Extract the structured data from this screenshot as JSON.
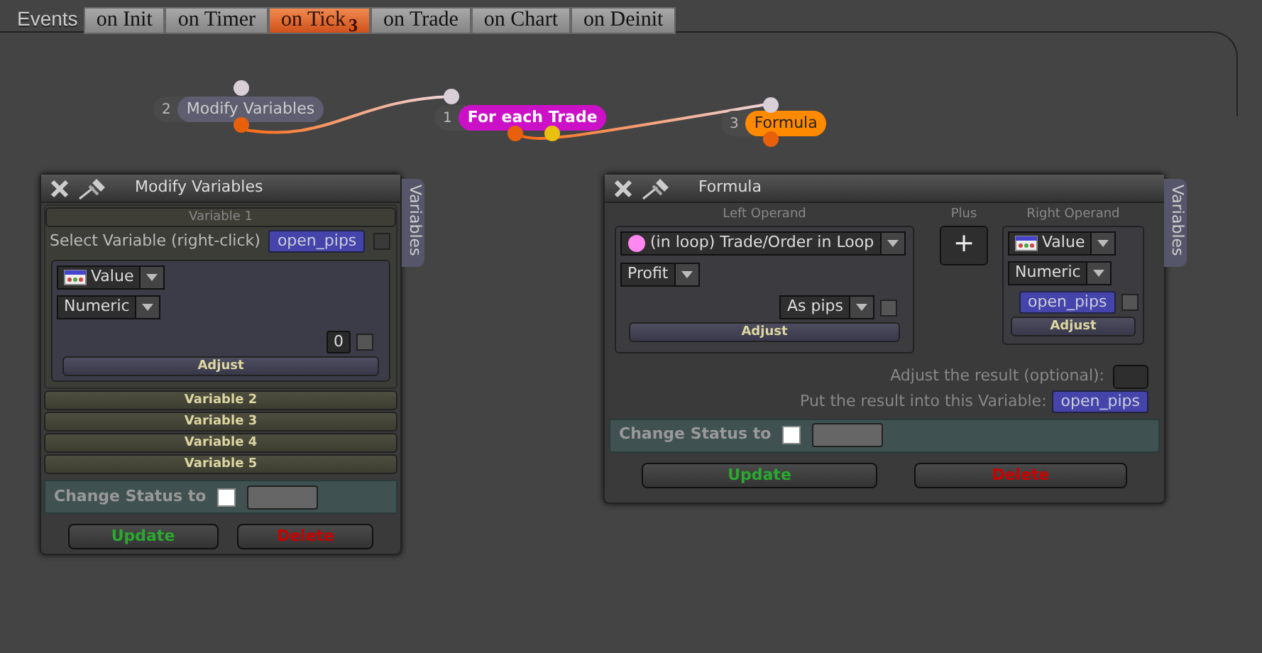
{
  "events_label": "Events",
  "tabs": [
    {
      "label": "on Init",
      "selected": false
    },
    {
      "label": "on Timer",
      "selected": false
    },
    {
      "label": "on Tick",
      "badge": "3",
      "selected": true
    },
    {
      "label": "on Trade",
      "selected": false
    },
    {
      "label": "on Chart",
      "selected": false
    },
    {
      "label": "on Deinit",
      "selected": false
    }
  ],
  "nodes": [
    {
      "number": "2",
      "label": "Modify Variables",
      "color": "#5e5e70"
    },
    {
      "number": "1",
      "label": "For each Trade",
      "color": "#cc10c8"
    },
    {
      "number": "3",
      "label": "Formula",
      "color": "#ff8a00"
    }
  ],
  "modify_window": {
    "title": "Modify Variables",
    "side_tab": "Variables",
    "sections": [
      {
        "title": "Variable 1",
        "expanded": true,
        "select_label": "Select Variable (right-click)",
        "variable": "open_pips",
        "variable_checked": false,
        "source": "Value",
        "type": "Numeric",
        "value": "0",
        "value_checked": false,
        "adjust": "Adjust"
      },
      {
        "title": "Variable 2",
        "expanded": false
      },
      {
        "title": "Variable 3",
        "expanded": false
      },
      {
        "title": "Variable 4",
        "expanded": false
      },
      {
        "title": "Variable 5",
        "expanded": false
      }
    ],
    "status_label": "Change Status to",
    "status_checked": false,
    "update": "Update",
    "delete": "Delete"
  },
  "formula_window": {
    "title": "Formula",
    "side_tab": "Variables",
    "left_operand": {
      "heading": "Left Operand",
      "source": "(in loop) Trade/Order in Loop",
      "field": "Profit",
      "mode": "As pips",
      "checked": false,
      "adjust": "Adjust"
    },
    "operator": {
      "heading": "Plus",
      "symbol": "+"
    },
    "right_operand": {
      "heading": "Right Operand",
      "source": "Value",
      "type": "Numeric",
      "variable": "open_pips",
      "checked": false,
      "adjust": "Adjust"
    },
    "adjust_label": "Adjust the result (optional):",
    "put_label": "Put the result into this Variable:",
    "result_variable": "open_pips",
    "status_label": "Change Status to",
    "status_checked": false,
    "update": "Update",
    "delete": "Delete"
  }
}
